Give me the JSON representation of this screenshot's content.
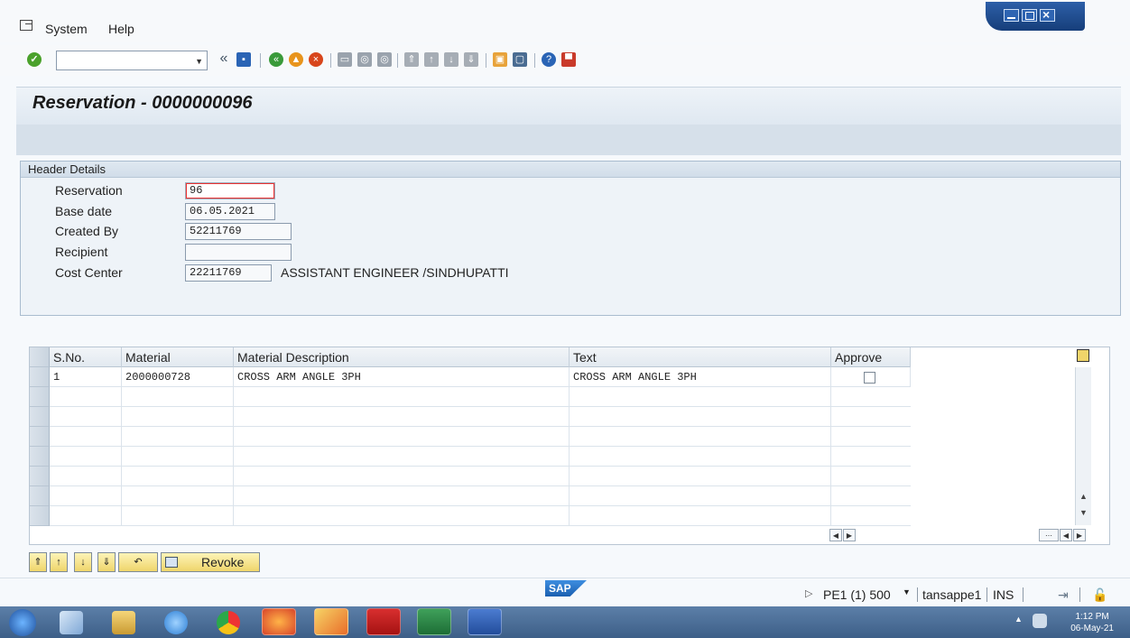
{
  "menu": {
    "system": "System",
    "help": "Help"
  },
  "toolbar": {
    "command_value": "",
    "back_glyph": "«"
  },
  "title": "Reservation - 0000000096",
  "header": {
    "group_title": "Header Details",
    "fields": {
      "reservation": {
        "label": "Reservation",
        "value": "96"
      },
      "base_date": {
        "label": "Base date",
        "value": "06.05.2021"
      },
      "created_by": {
        "label": "Created By",
        "value": "52211769"
      },
      "recipient": {
        "label": "Recipient",
        "value": ""
      },
      "cost_center": {
        "label": "Cost Center",
        "value": "22211769",
        "description": "ASSISTANT ENGINEER /SINDHUPATTI"
      }
    }
  },
  "table": {
    "columns": [
      "S.No.",
      "Material",
      "Material Description",
      "Text",
      "Approve"
    ],
    "rows": [
      {
        "sno": "1",
        "material": "2000000728",
        "description": "CROSS ARM ANGLE 3PH",
        "text": "CROSS ARM ANGLE 3PH",
        "approve": false
      }
    ]
  },
  "buttons": {
    "revoke": "Revoke"
  },
  "status": {
    "system": "PE1 (1) 500",
    "user": "tansappe1",
    "mode": "INS",
    "logo": "SAP"
  },
  "taskbar": {
    "time": "1:12 PM",
    "date": "06-May-21"
  },
  "colors": {
    "accent": "#1a5fb0",
    "ok": "#4aa12b",
    "button": "#efd56b"
  }
}
